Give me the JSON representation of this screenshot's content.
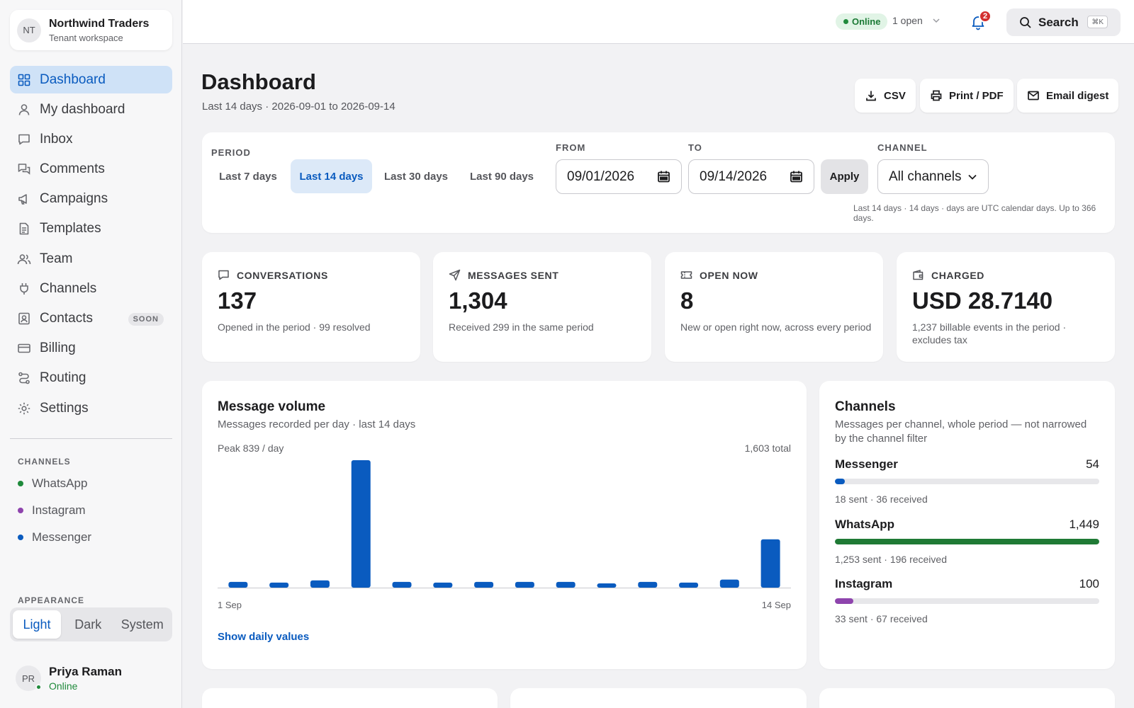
{
  "workspace": {
    "initials": "NT",
    "name": "Northwind Traders",
    "subtitle": "Tenant workspace"
  },
  "nav": [
    {
      "label": "Dashboard",
      "icon": "grid-icon",
      "active": true
    },
    {
      "label": "My dashboard",
      "icon": "user-icon"
    },
    {
      "label": "Inbox",
      "icon": "chat-icon"
    },
    {
      "label": "Comments",
      "icon": "comments-icon"
    },
    {
      "label": "Campaigns",
      "icon": "megaphone-icon"
    },
    {
      "label": "Templates",
      "icon": "document-icon"
    },
    {
      "label": "Team",
      "icon": "users-icon"
    },
    {
      "label": "Channels",
      "icon": "plug-icon"
    },
    {
      "label": "Contacts",
      "icon": "contact-card-icon",
      "badge": "SOON"
    },
    {
      "label": "Billing",
      "icon": "credit-card-icon"
    },
    {
      "label": "Routing",
      "icon": "route-icon"
    },
    {
      "label": "Settings",
      "icon": "gear-icon"
    }
  ],
  "sidebar_channels": {
    "label": "CHANNELS",
    "items": [
      {
        "label": "WhatsApp",
        "color": "#1f8a3b"
      },
      {
        "label": "Instagram",
        "color": "#8e44ad"
      },
      {
        "label": "Messenger",
        "color": "#0a5bbf"
      }
    ]
  },
  "appearance": {
    "label": "APPEARANCE",
    "options": [
      "Light",
      "Dark",
      "System"
    ],
    "selected": "Light"
  },
  "user": {
    "initials": "PR",
    "name": "Priya Raman",
    "status": "Online"
  },
  "topbar": {
    "status": "Online",
    "open_label": "1 open",
    "notifications": "2",
    "search_label": "Search",
    "search_shortcut": "⌘K"
  },
  "header": {
    "title": "Dashboard",
    "subtitle": "Last 14 days · 2026-09-01 to 2026-09-14",
    "actions": [
      "CSV",
      "Print / PDF",
      "Email digest"
    ]
  },
  "filters": {
    "period_label": "PERIOD",
    "periods": [
      "Last 7 days",
      "Last 14 days",
      "Last 30 days",
      "Last 90 days"
    ],
    "selected_period": "Last 14 days",
    "from_label": "FROM",
    "from_value": "09/01/2026",
    "to_label": "TO",
    "to_value": "09/14/2026",
    "apply_label": "Apply",
    "channel_label": "CHANNEL",
    "channel_value": "All channels",
    "note": "Last 14 days · 14 days · days are UTC calendar days. Up to 366 days."
  },
  "stats": [
    {
      "label": "CONVERSATIONS",
      "icon": "chat-icon",
      "value": "137",
      "note": "Opened in the period · 99 resolved"
    },
    {
      "label": "MESSAGES SENT",
      "icon": "send-icon",
      "value": "1,304",
      "note": "Received 299 in the same period"
    },
    {
      "label": "OPEN NOW",
      "icon": "ticket-icon",
      "value": "8",
      "note": "New or open right now, across every period"
    },
    {
      "label": "CHARGED",
      "icon": "wallet-icon",
      "value": "USD 28.7140",
      "note": "1,237 billable events in the period · excludes tax"
    }
  ],
  "volume": {
    "title": "Message volume",
    "subtitle": "Messages recorded per day · last 14 days",
    "peak": "Peak 839 / day",
    "total": "1,603 total",
    "x_start": "1 Sep",
    "x_end": "14 Sep",
    "link": "Show daily values",
    "bar_color": "#0a5bbf"
  },
  "chart_data": {
    "type": "bar",
    "categories": [
      "1 Sep",
      "2 Sep",
      "3 Sep",
      "4 Sep",
      "5 Sep",
      "6 Sep",
      "7 Sep",
      "8 Sep",
      "9 Sep",
      "10 Sep",
      "11 Sep",
      "12 Sep",
      "13 Sep",
      "14 Sep"
    ],
    "values": [
      38,
      33,
      48,
      839,
      38,
      33,
      38,
      38,
      38,
      28,
      38,
      33,
      53,
      318
    ],
    "ylim": [
      0,
      839
    ],
    "grid": false,
    "legend": "none"
  },
  "channels_card": {
    "title": "Channels",
    "subtitle": "Messages per channel, whole period — not narrowed by the channel filter",
    "rows": [
      {
        "name": "Messenger",
        "total": "54",
        "value": 54,
        "detail": "18 sent · 36 received",
        "color": "#0a5bbf"
      },
      {
        "name": "WhatsApp",
        "total": "1,449",
        "value": 1449,
        "detail": "1,253 sent · 196 received",
        "color": "#1f7a35"
      },
      {
        "name": "Instagram",
        "total": "100",
        "value": 100,
        "detail": "33 sent · 67 received",
        "color": "#8e44ad"
      }
    ]
  }
}
